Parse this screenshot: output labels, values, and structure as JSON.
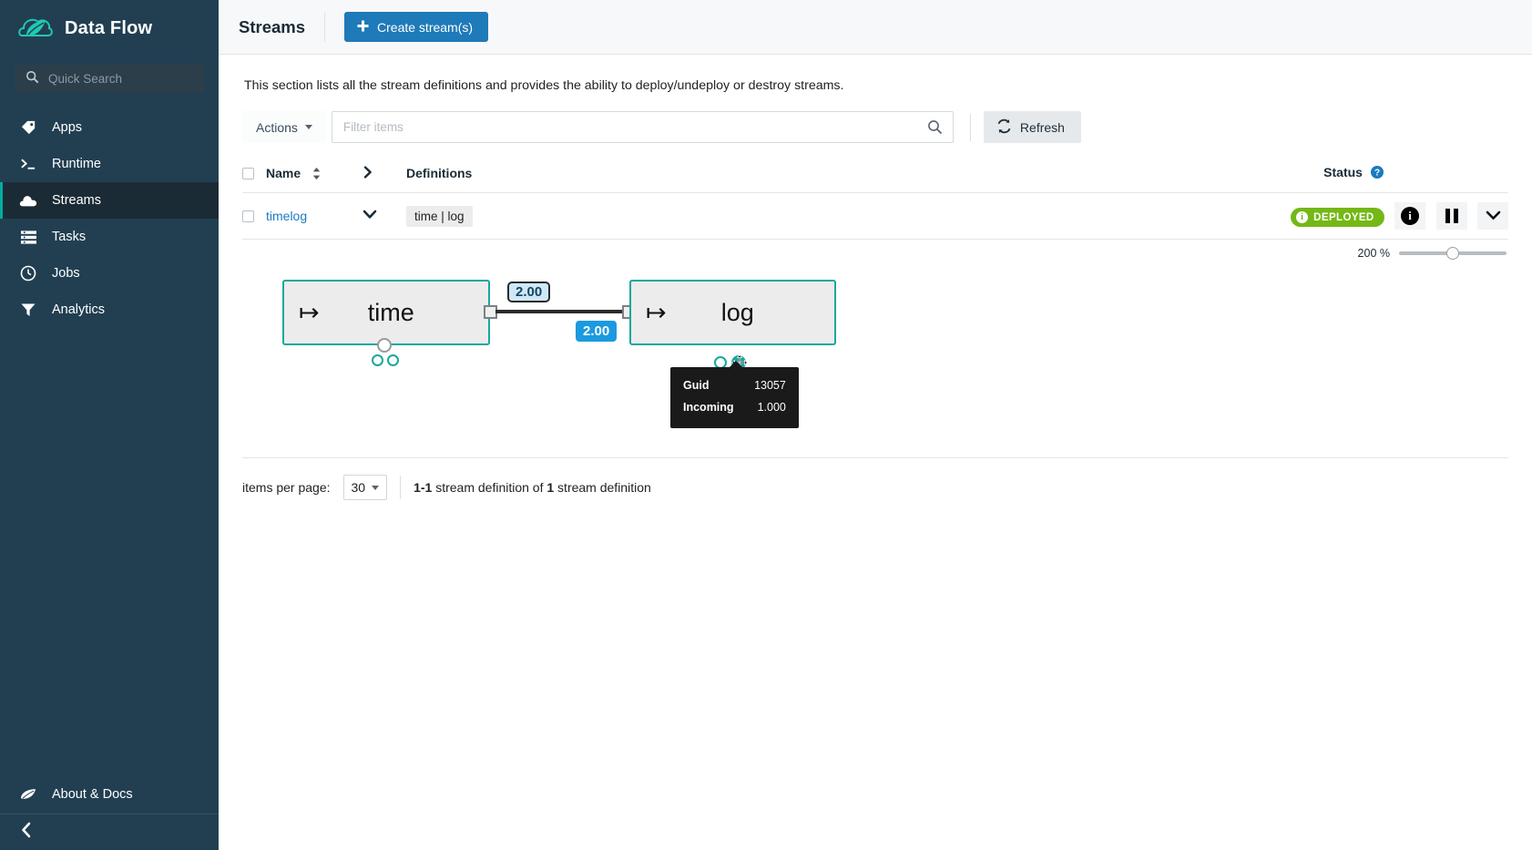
{
  "sidebar": {
    "brand": "Data Flow",
    "brand_logo_icon": "spring-leaf-cloud-icon",
    "search": {
      "placeholder": "Quick Search",
      "value": "",
      "icon": "search-icon"
    },
    "items": [
      {
        "label": "Apps",
        "icon": "tag-icon",
        "active": false
      },
      {
        "label": "Runtime",
        "icon": "terminal-icon",
        "active": false
      },
      {
        "label": "Streams",
        "icon": "cloud-icon",
        "active": true
      },
      {
        "label": "Tasks",
        "icon": "server-stack-icon",
        "active": false
      },
      {
        "label": "Jobs",
        "icon": "clock-icon",
        "active": false
      },
      {
        "label": "Analytics",
        "icon": "funnel-icon",
        "active": false
      }
    ],
    "about": {
      "label": "About & Docs",
      "icon": "leaf-icon"
    },
    "collapse_icon": "chevron-left-icon"
  },
  "header": {
    "title": "Streams",
    "create_button": "Create stream(s)",
    "create_icon": "plus-icon"
  },
  "page": {
    "lead": "This section lists all the stream definitions and provides the ability to deploy/undeploy or destroy streams."
  },
  "toolbar": {
    "actions_label": "Actions",
    "actions_caret_icon": "caret-down-icon",
    "filter_placeholder": "Filter items",
    "filter_value": "",
    "filter_search_icon": "search-icon",
    "refresh_label": "Refresh",
    "refresh_icon": "refresh-icon"
  },
  "table": {
    "headers": {
      "name": "Name",
      "definitions": "Definitions",
      "status": "Status"
    },
    "header_icons": {
      "sort": "sort-arrows-icon",
      "expand": "chevron-right-icon",
      "status_help": "help-circle-icon"
    },
    "rows": [
      {
        "name": "timelog",
        "definition": "time | log",
        "status": "DEPLOYED",
        "status_color": "#74b816",
        "expand_icon": "chevron-down-icon",
        "actions": [
          "info-icon",
          "pause-icon",
          "chevron-down-icon"
        ]
      }
    ]
  },
  "zoom_control": {
    "label": "200 %",
    "value": 200,
    "min": 0,
    "max": 400
  },
  "flow": {
    "nodes": [
      {
        "id": "time",
        "label": "time",
        "icon": "flow-arrow-icon"
      },
      {
        "id": "log",
        "label": "log",
        "icon": "flow-arrow-icon"
      }
    ],
    "link_labels": {
      "outgoing": "2.00",
      "incoming": "2.00"
    },
    "tooltip": {
      "rows": [
        {
          "key": "Guid",
          "value": "13057"
        },
        {
          "key": "Incoming",
          "value": "1.000"
        }
      ]
    },
    "cursor_icon": "move-cursor-icon"
  },
  "pager": {
    "items_per_page_label": "items per page:",
    "items_per_page_value": "30",
    "caret_icon": "caret-down-icon",
    "range": "1-1",
    "info_mid": " stream definition of ",
    "total": "1",
    "info_end": " stream definition"
  }
}
